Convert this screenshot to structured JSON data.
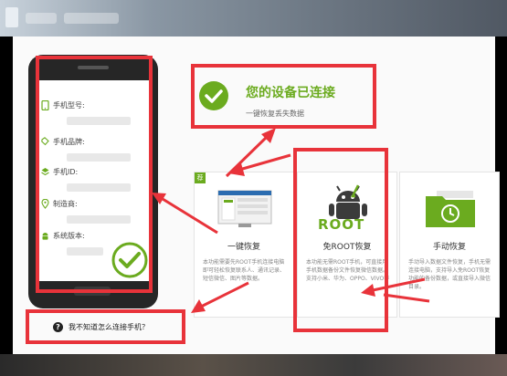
{
  "status": {
    "title": "您的设备已连接",
    "subtitle": "一键恢复丢失数据"
  },
  "phone_info": {
    "items": [
      {
        "label": "手机型号:",
        "icon": "phone-icon"
      },
      {
        "label": "手机品牌:",
        "icon": "tag-icon"
      },
      {
        "label": "手机ID:",
        "icon": "layers-icon"
      },
      {
        "label": "制造商:",
        "icon": "location-pin-icon"
      },
      {
        "label": "系统版本:",
        "icon": "android-icon"
      }
    ]
  },
  "help": {
    "label": "我不知道怎么连接手机？"
  },
  "cards": [
    {
      "name": "一键恢复",
      "badge": "荐",
      "desc": "本功能需要先ROOT手机连接电脑即可轻松恢复联系人、通讯记录、短信微信、图片等数据。"
    },
    {
      "name": "免ROOT恢复",
      "logo_text": "ROOT",
      "desc": "本功能无需ROOT手机，可直接用手机数据备份文件恢复微信数据。支持小米、华为、OPPO、VIVO等"
    },
    {
      "name": "手动恢复",
      "desc": "手动导入数据文件恢复，手机无需连接电脑，支持导入免ROOT恢复功能的备份数据，或直接导入微信目录。"
    }
  ],
  "colors": {
    "accent_green": "#6bab1f",
    "annotation_red": "#e8333a"
  }
}
